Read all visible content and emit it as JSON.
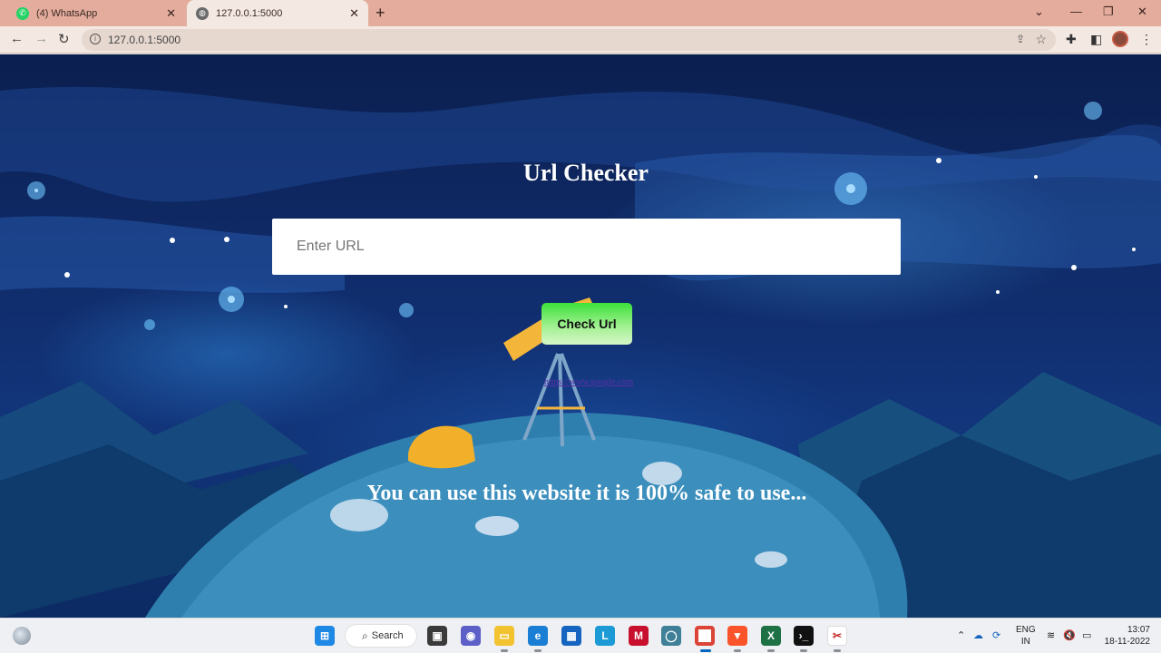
{
  "browser": {
    "tabs": [
      {
        "title": "(4) WhatsApp",
        "active": false
      },
      {
        "title": "127.0.0.1:5000",
        "active": true
      }
    ],
    "address": "127.0.0.1:5000"
  },
  "page": {
    "title": "Url Checker",
    "input_placeholder": "Enter URL",
    "input_value": "",
    "button_label": "Check Url",
    "result_link": "https://www.google.com",
    "message": "You can use this website it is 100% safe to use..."
  },
  "taskbar": {
    "search_label": "Search",
    "language_top": "ENG",
    "language_bottom": "IN",
    "time": "13:07",
    "date": "18-11-2022"
  },
  "colors": {
    "background_sky": "#0b1f4f",
    "button_green": "#3ce13a",
    "text_white": "#ffffff"
  }
}
